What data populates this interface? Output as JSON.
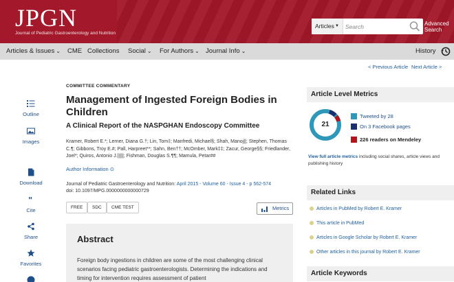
{
  "colors": {
    "brand_red": "#a3182a",
    "nav_bg": "#dadada",
    "link_blue": "#1f5fa0",
    "panel_gray": "#efefef"
  },
  "header": {
    "logo_text": "JPGN",
    "logo_subtitle": "Journal of Pediatric Gastroenterology and Nutrition",
    "search_scope": "Articles",
    "search_placeholder": "Search",
    "search_icon": "magnifier-icon",
    "advanced_search_line1": "Advanced",
    "advanced_search_line2": "Search"
  },
  "nav": {
    "items": [
      {
        "label": "Articles & Issues",
        "has_menu": true
      },
      {
        "label": "CME",
        "has_menu": false
      },
      {
        "label": "Collections",
        "has_menu": false
      },
      {
        "label": "Social",
        "has_menu": true
      },
      {
        "label": "For Authors",
        "has_menu": true
      },
      {
        "label": "Journal Info",
        "has_menu": true
      }
    ],
    "history_label": "History"
  },
  "pager": {
    "prev": "< Previous Article",
    "next": "Next Article >"
  },
  "rail": [
    {
      "label": "Outline",
      "icon": "outline-icon"
    },
    {
      "label": "Images",
      "icon": "images-icon"
    },
    {
      "label": "Download",
      "icon": "download-icon"
    },
    {
      "label": "Cite",
      "icon": "quote-icon"
    },
    {
      "label": "Share",
      "icon": "share-icon"
    },
    {
      "label": "Favorites",
      "icon": "star-icon"
    }
  ],
  "article": {
    "kicker": "COMMITTEE COMMENTARY",
    "title": "Management of Ingested Foreign Bodies in Children",
    "subtitle": "A Clinical Report of the NASPGHAN Endoscopy Committee",
    "authors": "Kramer, Robert E.*; Lerner, Diana G.†; Lin, Tom‡; Manfredi, Michael§; Shah, Manoj||; Stephen, Thomas C.¶; Gibbons, Troy E.#; Pall, Harpreet**; Sahn, Ben††; McOmber, Mark‡‡; Zacur, George§§; Friedlander, Joel*; Quiros, Antonio J.|||||; Fishman, Douglas S.¶¶; Mamula, Petar##",
    "author_info_label": "Author Information",
    "journal_prefix": "Journal of Pediatric Gastroenterology and Nutrition: ",
    "journal_issue": "April 2015 - Volume 60 - Issue 4 - p 562-574",
    "doi": "doi: 10.1097/MPG.0000000000000729",
    "tags": [
      "FREE",
      "SDC",
      "CME TEST"
    ],
    "metrics_button": "Metrics",
    "abstract_title": "Abstract",
    "abstract_text": "Foreign body ingestions in children are some of the most challenging clinical scenarios facing pediatric gastroenterologists. Determining the indications and timing for intervention requires assessment of patient"
  },
  "sidebar": {
    "metrics_heading": "Article Level Metrics",
    "altmetric_score": "21",
    "tweeted": "Tweeted by 28",
    "facebook": "On 3 Facebook pages",
    "mendeley": "226 readers on Mendeley",
    "full_metrics_link": "View full article metrics",
    "full_metrics_text": " including social shares, article views and publishing history",
    "related_heading": "Related Links",
    "related_links": [
      "Articles in PubMed by Robert E. Kramer",
      "This article in PubMed",
      "Articles in Google Scholar by Robert E. Kramer",
      "Other articles in this journal by Robert E. Kramer"
    ],
    "keywords_heading": "Article Keywords",
    "metric_colors": {
      "twitter": "#2f98b8",
      "facebook": "#1c2f6e",
      "mendeley": "#b2161c"
    }
  }
}
